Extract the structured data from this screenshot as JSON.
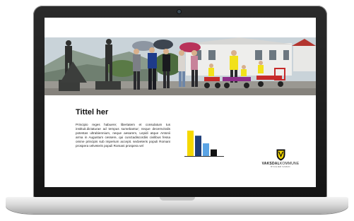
{
  "slide": {
    "title": "Tittel her",
    "body": "Principio reges habuere; libertatem et consulatum tus instituit.dictaturae ad tempus sumebantur; neque decemviralis potestas ultrabiennium, neque aesarem, Lepidi atque Antonii arma in Augustum cessere, qui cunctadiscordiis civilibus fessa omine principis sub imperium accepit. sedveteris populi Romani prospera velveteris populi Romani prospera vel"
  },
  "logo": {
    "name_bold": "VAKSDAL",
    "name_light": "KOMMUNE",
    "tagline": "BYGGJER SAMAN"
  },
  "chart_data": {
    "type": "bar",
    "categories": [
      "",
      "",
      "",
      ""
    ],
    "values": [
      5,
      4,
      2.5,
      1.3
    ],
    "colors": [
      "#f5d800",
      "#1f3f7a",
      "#5ba4e5",
      "#111111"
    ],
    "ylim": [
      0,
      5
    ],
    "grid": false
  }
}
